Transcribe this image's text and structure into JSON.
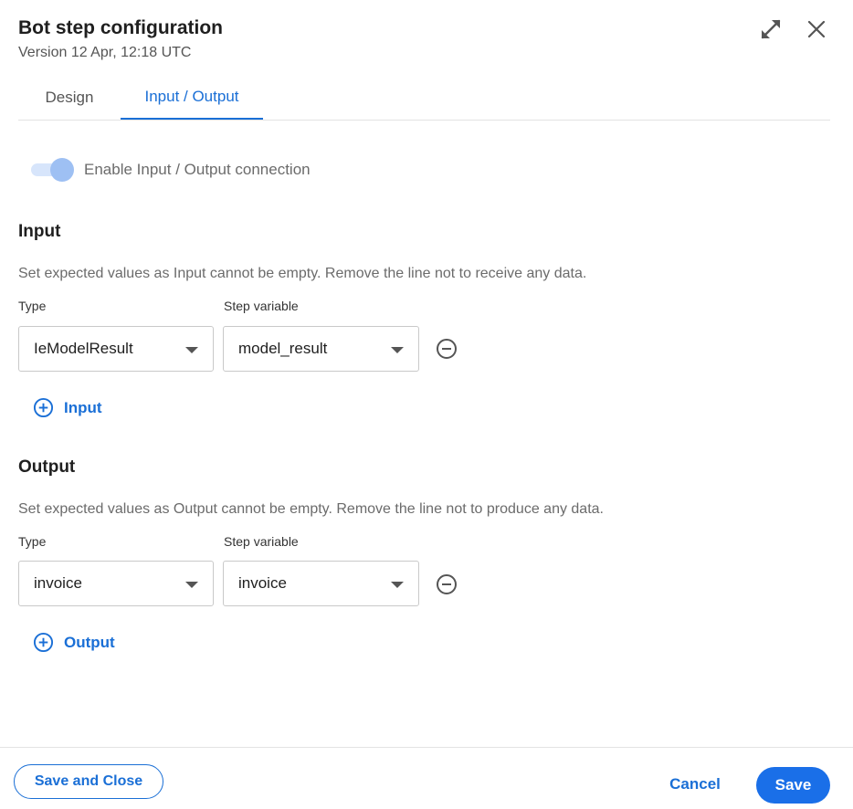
{
  "header": {
    "title": "Bot step configuration",
    "version": "Version 12 Apr, 12:18 UTC"
  },
  "tabs": [
    {
      "label": "Design",
      "active": false
    },
    {
      "label": "Input / Output",
      "active": true
    }
  ],
  "toggle": {
    "label": "Enable Input / Output connection",
    "enabled": true
  },
  "input": {
    "title": "Input",
    "description": "Set expected values as Input cannot be empty. Remove the line not to receive any data.",
    "type_label": "Type",
    "variable_label": "Step variable",
    "rows": [
      {
        "type": "IeModelResult",
        "variable": "model_result"
      }
    ],
    "add_label": "Input"
  },
  "output": {
    "title": "Output",
    "description": "Set expected values as Output cannot be empty. Remove the line not to produce any data.",
    "type_label": "Type",
    "variable_label": "Step variable",
    "rows": [
      {
        "type": "invoice",
        "variable": "invoice"
      }
    ],
    "add_label": "Output"
  },
  "footer": {
    "save_close_label": "Save and Close",
    "cancel_label": "Cancel",
    "save_label": "Save"
  },
  "colors": {
    "accent": "#1a6fd6",
    "primary_button": "#1a6fe8"
  }
}
